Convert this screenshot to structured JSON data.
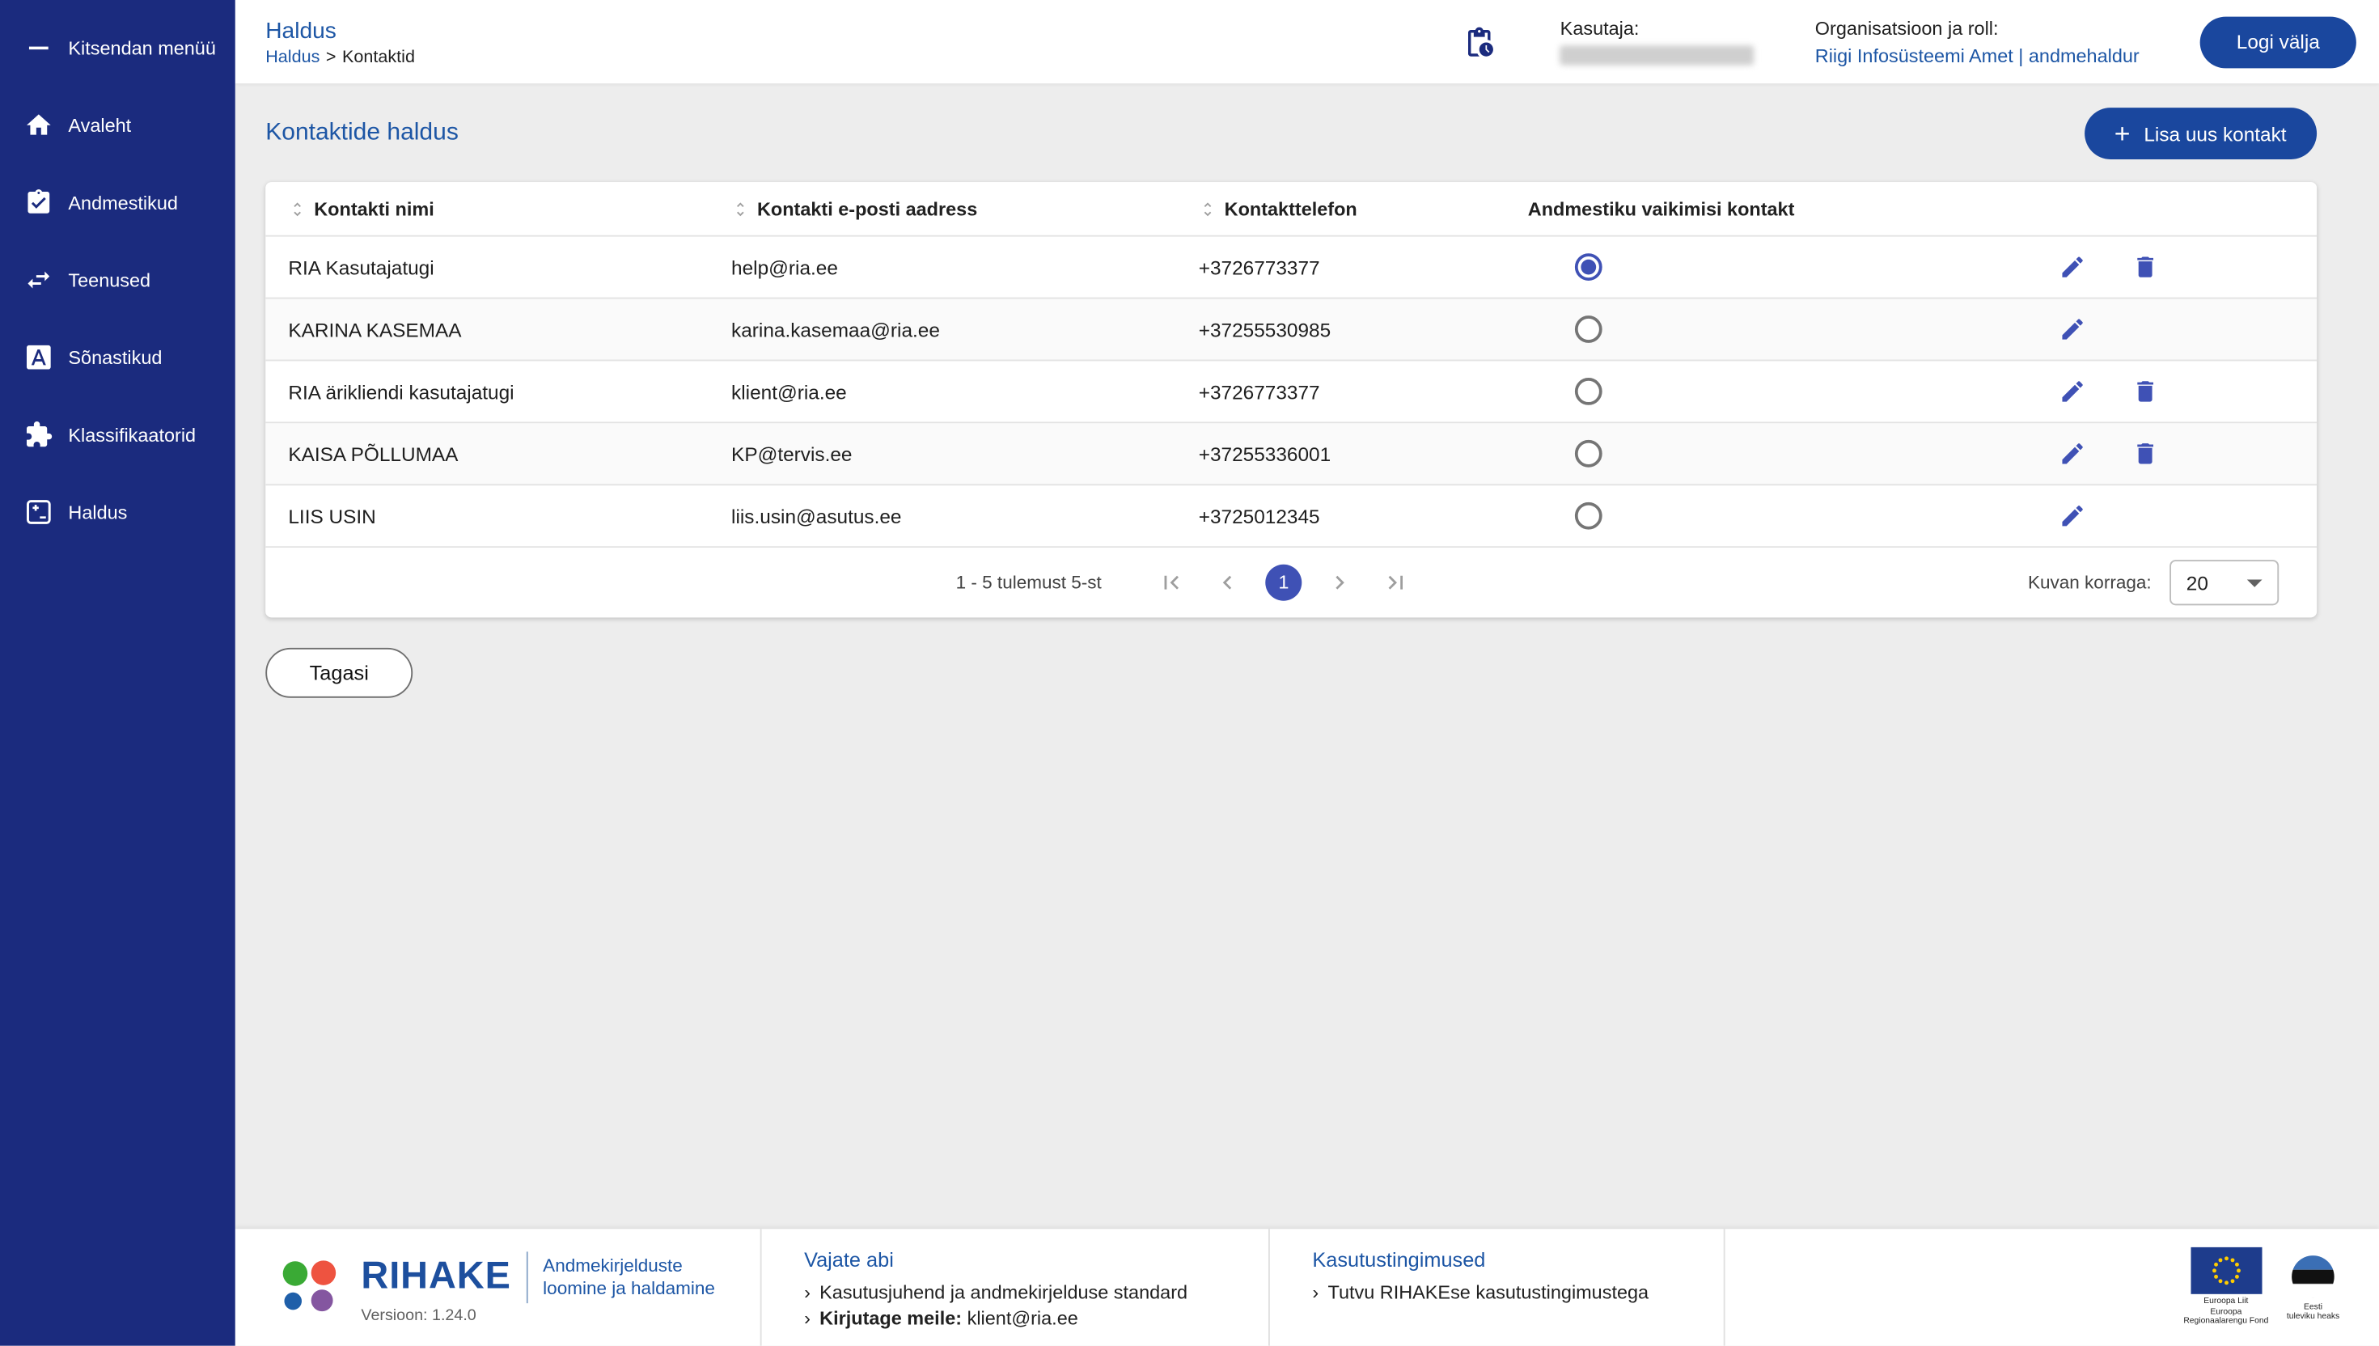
{
  "colors": {
    "sidebar-bg": "#1b2b7e",
    "accent": "#1d56a5",
    "button-blue": "#1a479e",
    "indigo": "#3f51b5",
    "page-bg": "#ededed"
  },
  "sidebar": {
    "items": [
      {
        "label": "Kitsendan menüü",
        "icon": "collapse-menu-icon"
      },
      {
        "label": "Avaleht",
        "icon": "home-icon"
      },
      {
        "label": "Andmestikud",
        "icon": "datasets-icon"
      },
      {
        "label": "Teenused",
        "icon": "services-icon"
      },
      {
        "label": "Sõnastikud",
        "icon": "dictionaries-icon"
      },
      {
        "label": "Klassifikaatorid",
        "icon": "classifiers-icon"
      },
      {
        "label": "Haldus",
        "icon": "admin-icon"
      }
    ]
  },
  "header": {
    "title": "Haldus",
    "breadcrumb": {
      "root": "Haldus",
      "separator": ">",
      "current": "Kontaktid"
    },
    "user_label": "Kasutaja:",
    "org_label": "Organisatsioon ja roll:",
    "org_value": "Riigi Infosüsteemi Amet | andmehaldur",
    "logout_label": "Logi välja"
  },
  "main": {
    "page_title": "Kontaktide haldus",
    "add_button_plus": "+",
    "add_button_label": "Lisa uus kontakt",
    "table": {
      "columns": [
        "Kontakti nimi",
        "Kontakti e-posti aadress",
        "Kontakttelefon",
        "Andmestiku vaikimisi kontakt"
      ],
      "rows": [
        {
          "name": "RIA Kasutajatugi",
          "email": "help@ria.ee",
          "phone": "+3726773377",
          "is_default": true,
          "can_delete": true
        },
        {
          "name": "KARINA KASEMAA",
          "email": "karina.kasemaa@ria.ee",
          "phone": "+37255530985",
          "is_default": false,
          "can_delete": false
        },
        {
          "name": "RIA ärikliendi kasutajatugi",
          "email": "klient@ria.ee",
          "phone": "+3726773377",
          "is_default": false,
          "can_delete": true
        },
        {
          "name": "KAISA PÕLLUMAA",
          "email": "KP@tervis.ee",
          "phone": "+37255336001",
          "is_default": false,
          "can_delete": true
        },
        {
          "name": "LIIS USIN",
          "email": "liis.usin@asutus.ee",
          "phone": "+3725012345",
          "is_default": false,
          "can_delete": false
        }
      ]
    },
    "pagination": {
      "summary": "1 - 5 tulemust 5-st",
      "current_page": "1",
      "per_page_label": "Kuvan korraga:",
      "per_page_value": "20"
    },
    "back_button_label": "Tagasi"
  },
  "footer": {
    "brand_name": "RIHAKE",
    "tagline_lines": [
      "Andmekirjelduste",
      "loomine ja haldamine"
    ],
    "version": "Versioon: 1.24.0",
    "help": {
      "heading": "Vajate abi",
      "bullet": "›",
      "link1": "Kasutusjuhend ja andmekirjelduse standard",
      "link2_prefix": "Kirjutage meile:",
      "link2_value": "klient@ria.ee"
    },
    "terms": {
      "heading": "Kasutustingimused",
      "bullet": "›",
      "link1": "Tutvu RIHAKEse kasutustingimustega"
    },
    "eu": {
      "lines": [
        "Euroopa Liit",
        "Euroopa",
        "Regionaalarengu Fond"
      ]
    },
    "ee": {
      "lines": [
        "Eesti",
        "tuleviku heaks"
      ]
    }
  }
}
